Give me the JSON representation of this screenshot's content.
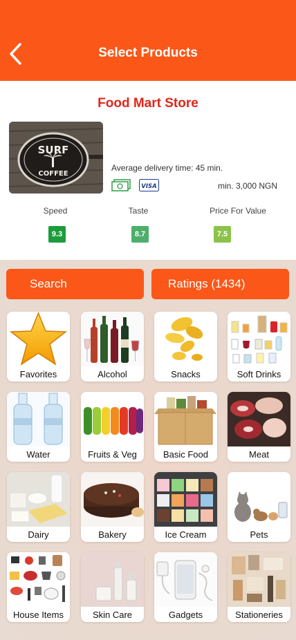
{
  "header": {
    "title": "Select Products",
    "back_icon": "back-arrow-icon"
  },
  "store": {
    "name": "Food Mart Store",
    "logo_text_top": "SURF",
    "logo_text_bottom": "COFFEE",
    "delivery": "Average delivery time: 45 min.",
    "min_order": "min. 3,000 NGN",
    "payment_cash_icon": "cash-icon",
    "payment_visa": "VISA"
  },
  "ratings": [
    {
      "label": "Speed",
      "value": "9.3",
      "color": "#1e9c3d"
    },
    {
      "label": "Taste",
      "value": "8.7",
      "color": "#4caf6a"
    },
    {
      "label": "Price For Value",
      "value": "7.5",
      "color": "#8bc34a"
    }
  ],
  "actions": {
    "search_label": "Search",
    "ratings_label": "Ratings (1434)"
  },
  "categories": [
    {
      "label": "Favorites",
      "icon": "star-icon"
    },
    {
      "label": "Alcohol",
      "icon": "wine-bottles-icon"
    },
    {
      "label": "Snacks",
      "icon": "chips-icon"
    },
    {
      "label": "Soft Drinks",
      "icon": "drinks-icon"
    },
    {
      "label": "Water",
      "icon": "water-bottles-icon"
    },
    {
      "label": "Fruits & Veg",
      "icon": "vegetables-icon"
    },
    {
      "label": "Basic Food",
      "icon": "grocery-box-icon"
    },
    {
      "label": "Meat",
      "icon": "meat-icon"
    },
    {
      "label": "Dairy",
      "icon": "dairy-icon"
    },
    {
      "label": "Bakery",
      "icon": "cake-icon"
    },
    {
      "label": "Ice Cream",
      "icon": "ice-cream-icon"
    },
    {
      "label": "Pets",
      "icon": "pets-icon"
    },
    {
      "label": "House Items",
      "icon": "kitchenware-icon"
    },
    {
      "label": "Skin Care",
      "icon": "skin-care-icon"
    },
    {
      "label": "Gadgets",
      "icon": "gadgets-icon"
    },
    {
      "label": "Stationeries",
      "icon": "stationery-icon"
    }
  ]
}
